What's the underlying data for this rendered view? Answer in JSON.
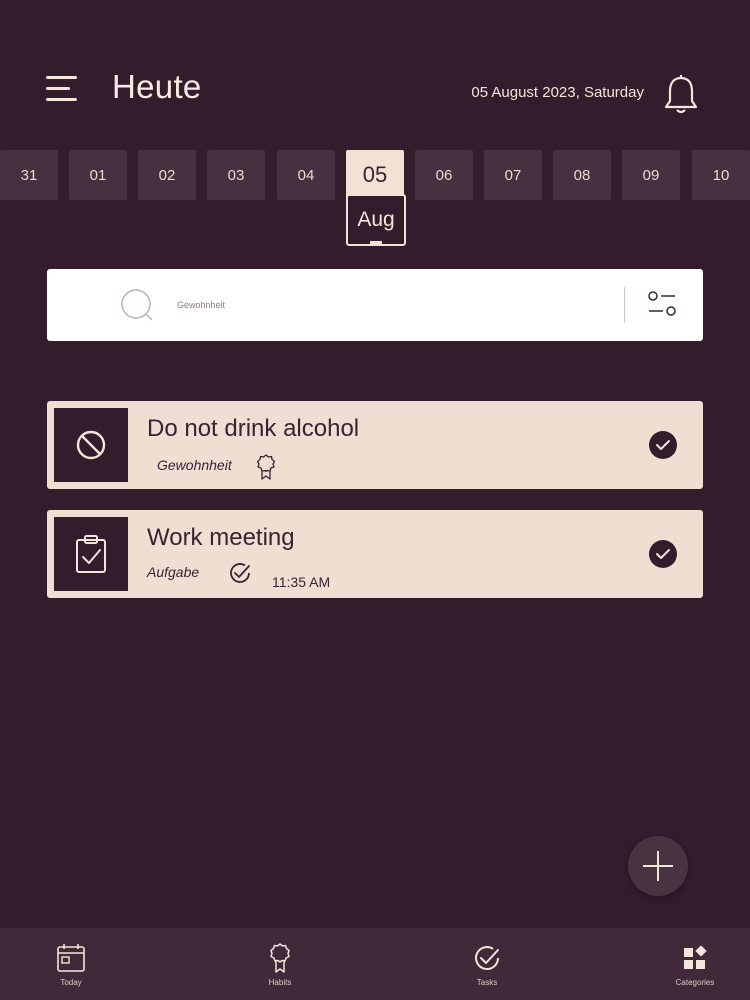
{
  "header": {
    "title": "Heute",
    "date": "05 August 2023, Saturday"
  },
  "day_strip": {
    "days": [
      "31",
      "01",
      "02",
      "03",
      "04",
      "05",
      "06",
      "07",
      "08",
      "09",
      "10"
    ],
    "selected_day": "05",
    "selected_month": "Aug"
  },
  "search": {
    "placeholder": "Gewohnheit"
  },
  "items": [
    {
      "title": "Do not drink alcohol",
      "type": "Gewohnheit",
      "icon": "prohibited-icon",
      "badge_icon": "award-icon",
      "completed": true
    },
    {
      "title": "Work meeting",
      "type": "Aufgabe",
      "icon": "clipboard-check-icon",
      "badge_icon": "check-circle-icon",
      "time": "11:35 AM",
      "completed": true
    }
  ],
  "tabs": [
    {
      "label": "Today",
      "icon": "calendar-icon"
    },
    {
      "label": "Habits",
      "icon": "award-icon"
    },
    {
      "label": "Tasks",
      "icon": "check-circle-icon"
    },
    {
      "label": "Categories",
      "icon": "categories-icon"
    }
  ],
  "colors": {
    "background": "#331c2c",
    "card": "#efdfd2",
    "accent_text": "#f3e6da"
  }
}
